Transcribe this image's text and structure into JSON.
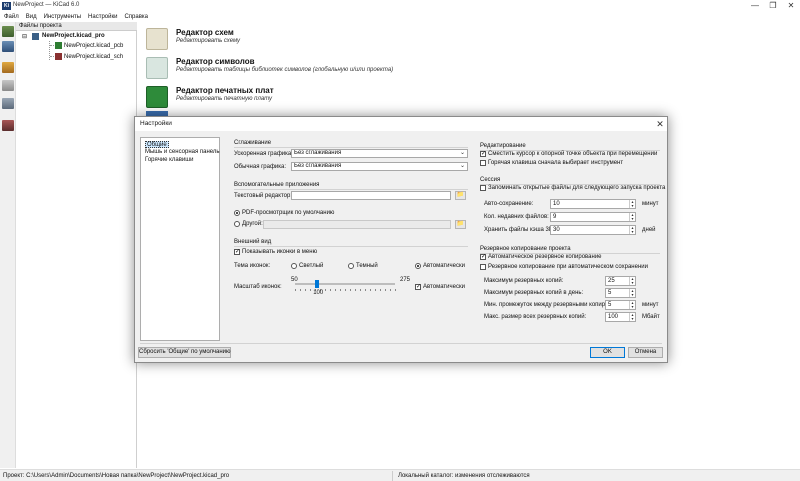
{
  "window": {
    "title": "NewProject — KiCad 6.0",
    "icon_text": "Ki",
    "minimize": "—",
    "maximize": "❐",
    "close": "✕"
  },
  "menubar": [
    "Файл",
    "Вид",
    "Инструменты",
    "Настройки",
    "Справка"
  ],
  "tree": {
    "header": "Файлы проекта",
    "expander": "⊟",
    "items": [
      "NewProject.kicad_pro",
      "NewProject.kicad_pcb",
      "NewProject.kicad_sch"
    ]
  },
  "launchers": [
    {
      "title": "Редактор схем",
      "desc": "Редактировать схему"
    },
    {
      "title": "Редактор символов",
      "desc": "Редактировать таблицы библиотек символов (глобальную и/или проекта)"
    },
    {
      "title": "Редактор печатных плат",
      "desc": "Редактировать печатную плату"
    }
  ],
  "statusbar": {
    "path": "Проект: C:\\Users\\Admin\\Documents\\Новая папка\\NewProject\\NewProject.kicad_pro",
    "watch": "Локальный каталог: изменения отслеживаются"
  },
  "dialog": {
    "title": "Настройки",
    "close": "✕",
    "nav": [
      "Общие",
      "Мышь и сенсорная панель",
      "Горячие клавиши"
    ],
    "smoothing": {
      "header": "Сглаживание",
      "accel_label": "Ускоренная графика:",
      "accel_value": "Без сглаживания",
      "fallback_label": "Обычная графика:",
      "fallback_value": "Без сглаживания"
    },
    "helpers": {
      "header": "Вспомогательные приложения",
      "text_editor_label": "Текстовый редактор:",
      "text_editor_value": "",
      "pdf_default": "PDF-просмотрщик по умолчанию",
      "pdf_other": "Другой:",
      "browse_icon": "📁"
    },
    "appearance": {
      "header": "Внешний вид",
      "show_icons": "Показывать иконки в меню",
      "theme_label": "Тема иконок:",
      "theme_light": "Светлый",
      "theme_dark": "Темный",
      "theme_auto": "Автоматически",
      "scale_label": "Масштаб иконок:",
      "scale_min": "50",
      "scale_max": "275",
      "scale_value": "100",
      "scale_fraction": 0.222,
      "scale_auto": "Автоматически"
    },
    "editing": {
      "header": "Редактирование",
      "warp_mouse": "Сместить курсор к опорной точке объекта при перемещении",
      "hotkey_first": "Горячая клавиша сначала выбирает инструмент"
    },
    "session": {
      "header": "Сессия",
      "remember_files": "Запоминать открытые файлы для следующего запуска проекта",
      "autosave_label": "Авто-сохранение:",
      "autosave_value": "10",
      "autosave_unit": "минут",
      "recent_label": "Кол. недавних файлов:",
      "recent_value": "9",
      "cache_label": "Хранить файлы кэша 3D:",
      "cache_value": "30",
      "cache_unit": "дней"
    },
    "backup": {
      "header": "Резервное копирование проекта",
      "auto_backup": "Автоматическое резервное копирование",
      "backup_on_autosave": "Резервное копирование при автоматическом сохранении",
      "max_label": "Максимум резервных копий:",
      "max_value": "25",
      "per_day_label": "Максимум резервных копий в день:",
      "per_day_value": "5",
      "interval_label": "Мин. промежуток между резервными копир.:",
      "interval_value": "5",
      "interval_unit": "минут",
      "size_label": "Макс. размер всех резервных копий:",
      "size_value": "100",
      "size_unit": "Мбайт"
    },
    "reset_button": "Сбросить 'Общие' по умолчанию",
    "ok_button": "OK",
    "cancel_button": "Отмена"
  },
  "colors": {
    "accent": "#0078d7",
    "nav_selected": "#cde8ff",
    "dialog_bg": "#f0f0f0"
  }
}
